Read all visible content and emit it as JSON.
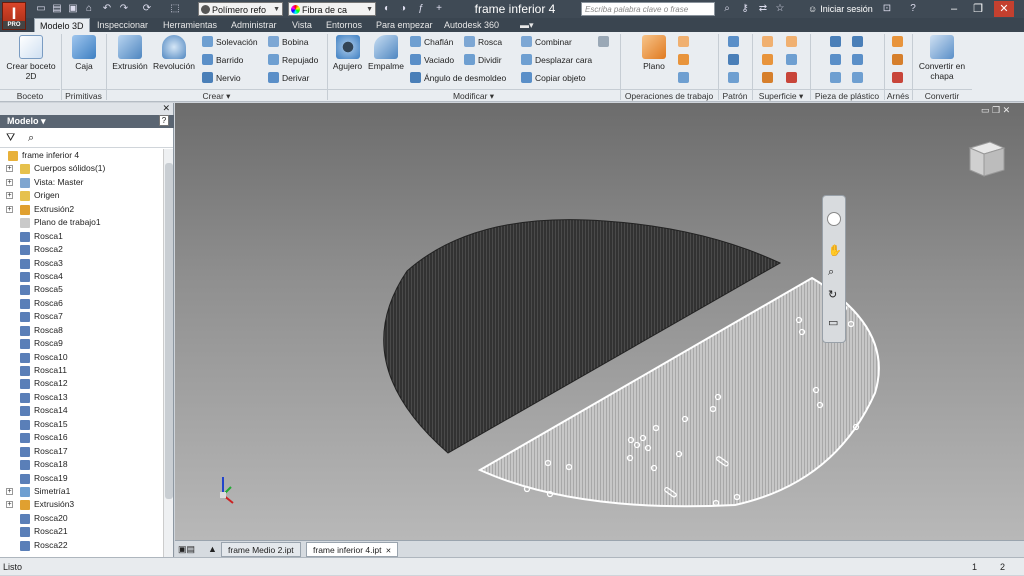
{
  "app": {
    "logo_letter": "I",
    "logo_sub": "PRO",
    "document_title": "frame inferior 4"
  },
  "quick_access": {
    "material": "Polímero refo",
    "appearance": "Fibra de ca",
    "search_placeholder": "Escriba palabra clave o frase",
    "login": "Iniciar sesión",
    "icons": [
      "new-icon",
      "open-icon",
      "save-icon",
      "undo-icon",
      "redo-icon",
      "home-icon",
      "select-icon",
      "material-icon",
      "appearance-icon",
      "fx-icon",
      "add-icon",
      "search-icon",
      "binoculars-icon",
      "key-icon",
      "star-icon",
      "user-icon",
      "help-icon"
    ]
  },
  "tabs": [
    "Modelo 3D",
    "Inspeccionar",
    "Herramientas",
    "Administrar",
    "Vista",
    "Entornos",
    "Para empezar",
    "Autodesk 360"
  ],
  "ribbon": {
    "create_sketch": "Crear boceto 2D",
    "box": "Caja",
    "extrude": "Extrusión",
    "revolve": "Revolución",
    "loft": "Solevación",
    "sweep": "Barrido",
    "rib": "Nervio",
    "coil": "Bobina",
    "emboss": "Repujado",
    "derive": "Derivar",
    "hole": "Agujero",
    "fillet": "Empalme",
    "chamfer": "Chaflán",
    "shell": "Vaciado",
    "draft": "Ángulo de desmoldeo",
    "thread": "Rosca",
    "split": "Dividir",
    "combine": "Combinar",
    "move_face": "Desplazar cara",
    "copy_object": "Copiar objeto",
    "plane": "Plano",
    "panels": {
      "sketch": "Boceto",
      "primitives": "Primitivas",
      "create": "Crear ▾",
      "modify": "Modificar ▾",
      "work_features": "Operaciones de trabajo",
      "pattern": "Patrón",
      "surface": "Superficie ▾",
      "plastic_part": "Pieza de plástico",
      "harness": "Arnés",
      "convert": "Convertir"
    },
    "convert_sheet": "Convertir en chapa"
  },
  "browser": {
    "title": "Modelo ▾",
    "nodes": [
      {
        "label": "frame inferior 4",
        "type": "part",
        "expand": ""
      },
      {
        "label": "Cuerpos sólidos(1)",
        "type": "folder",
        "expand": "+"
      },
      {
        "label": "Vista: Master",
        "type": "view",
        "expand": "+"
      },
      {
        "label": "Origen",
        "type": "folder",
        "expand": "+"
      },
      {
        "label": "Extrusión2",
        "type": "feature",
        "expand": "+"
      },
      {
        "label": "Plano de trabajo1",
        "type": "plane",
        "expand": ""
      },
      {
        "label": "Rosca1",
        "type": "thread",
        "expand": ""
      },
      {
        "label": "Rosca2",
        "type": "thread",
        "expand": ""
      },
      {
        "label": "Rosca3",
        "type": "thread",
        "expand": ""
      },
      {
        "label": "Rosca4",
        "type": "thread",
        "expand": ""
      },
      {
        "label": "Rosca5",
        "type": "thread",
        "expand": ""
      },
      {
        "label": "Rosca6",
        "type": "thread",
        "expand": ""
      },
      {
        "label": "Rosca7",
        "type": "thread",
        "expand": ""
      },
      {
        "label": "Rosca8",
        "type": "thread",
        "expand": ""
      },
      {
        "label": "Rosca9",
        "type": "thread",
        "expand": ""
      },
      {
        "label": "Rosca10",
        "type": "thread",
        "expand": ""
      },
      {
        "label": "Rosca11",
        "type": "thread",
        "expand": ""
      },
      {
        "label": "Rosca12",
        "type": "thread",
        "expand": ""
      },
      {
        "label": "Rosca13",
        "type": "thread",
        "expand": ""
      },
      {
        "label": "Rosca14",
        "type": "thread",
        "expand": ""
      },
      {
        "label": "Rosca15",
        "type": "thread",
        "expand": ""
      },
      {
        "label": "Rosca16",
        "type": "thread",
        "expand": ""
      },
      {
        "label": "Rosca17",
        "type": "thread",
        "expand": ""
      },
      {
        "label": "Rosca18",
        "type": "thread",
        "expand": ""
      },
      {
        "label": "Rosca19",
        "type": "thread",
        "expand": ""
      },
      {
        "label": "Simetría1",
        "type": "mirror",
        "expand": "+"
      },
      {
        "label": "Extrusión3",
        "type": "feature",
        "expand": "+"
      },
      {
        "label": "Rosca20",
        "type": "thread",
        "expand": ""
      },
      {
        "label": "Rosca21",
        "type": "thread",
        "expand": ""
      },
      {
        "label": "Rosca22",
        "type": "thread",
        "expand": ""
      }
    ]
  },
  "doc_tabs": [
    {
      "label": "frame Medio 2.ipt",
      "active": false
    },
    {
      "label": "frame inferior 4.ipt",
      "active": true
    }
  ],
  "status": {
    "text": "Listo",
    "count1": "1",
    "count2": "2"
  },
  "colors": {
    "titlebar": "#3f4a55",
    "ribbon": "#e9edf1",
    "accent": "#2e6db4"
  }
}
